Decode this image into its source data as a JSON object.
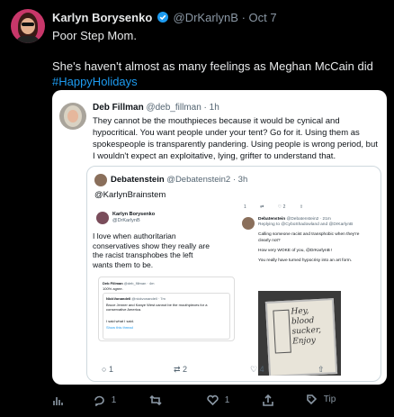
{
  "tweet": {
    "author_name": "Karlyn Borysenko",
    "author_handle": "@DrKarlynB",
    "date": "Oct 7",
    "verified": true,
    "text_line1": "Poor Step Mom.",
    "text_line2": "She's haven't almost as many feelings as Meghan McCain did",
    "hashtag": "#HappyHolidays",
    "actions": {
      "reply_count": "1",
      "like_count": "1",
      "tip_label": "Tip"
    }
  },
  "quoted": {
    "author_name": "Deb Fillman",
    "author_handle": "@deb_fillman",
    "time": "1h",
    "text": "They cannot be the mouthpieces because it would be cynical and hypocritical. You want people under your tent? Go for it. Using them as spokespeople is transparently pandering. Using people is wrong period, but I wouldn't expect an exploitative, lying, grifter to understand that.",
    "inner": {
      "author_name": "Debatenstein",
      "author_handle": "@Debatenstein2",
      "time": "3h",
      "text": "@KarlynBrainstem",
      "left_panel": {
        "name": "Karlyn Borysenko",
        "handle": "@DrKarlynB",
        "big_text_1": "I love when authoritarian",
        "big_text_2": "conservatives show they really are",
        "big_text_3": "the racist transphobes the left",
        "big_text_4": "wants them to be.",
        "sub_name": "Deb Fillman",
        "sub_handle": "@deb_fillman · 4m",
        "sub_text": "100% agree.",
        "nested_name": "NickVonandell",
        "nested_handle": "@nickvonandell · 7m",
        "nested_text": "Bruce Jenner and Kanye West cannot be the mouthpieces for a conservative America.",
        "nested_text2": "I said what I said.",
        "show_thread": "Show this thread"
      },
      "right_panel": {
        "name": "Debatenstein",
        "handle": "@Debatenstein2 · 21m",
        "replying": "Replying to @CyboShadowland and @DrKarlynB",
        "line1": "Calling someone racist and transphobic when they're clearly not?",
        "line2": "How very WOKE of you, @DrKarlynB !",
        "line3": "You really have turned hypocrisy into an art form.",
        "sign_text": "Hey, blood sucker, Enjoy"
      },
      "counts": {
        "reply": "1",
        "retweet": "2",
        "like": "4",
        "top_reply": "1",
        "top_like": "2"
      }
    }
  }
}
